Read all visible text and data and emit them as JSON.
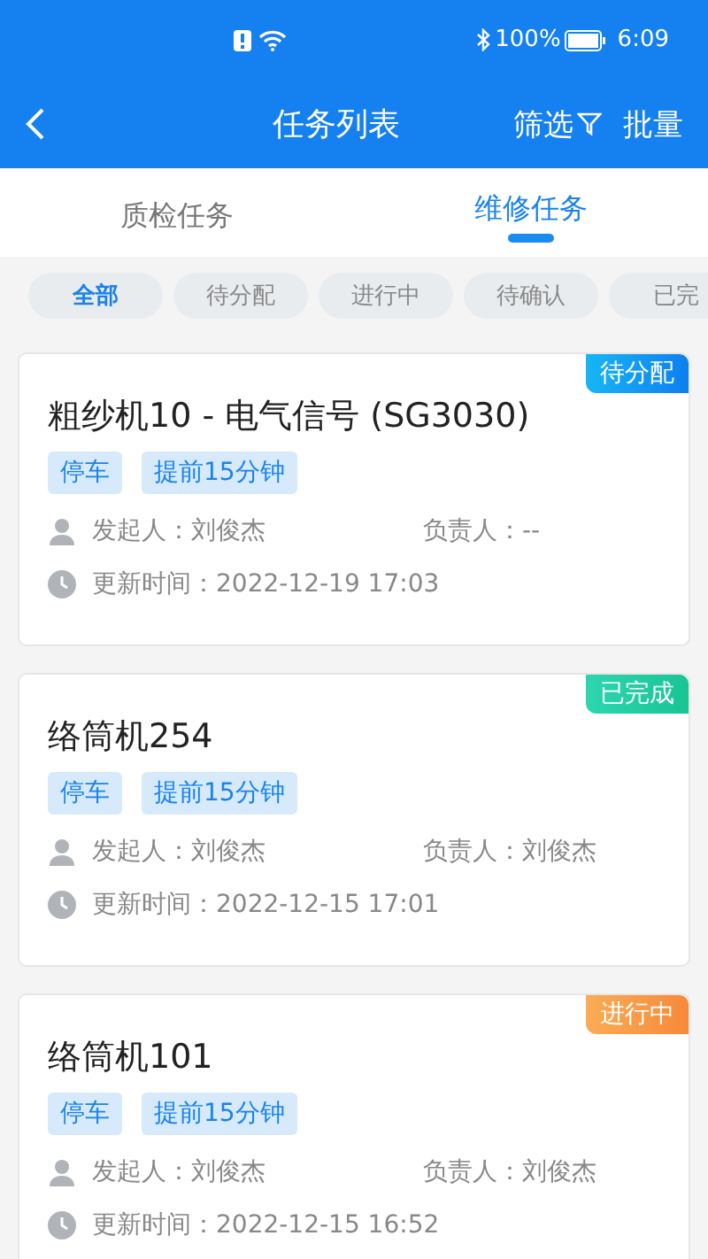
{
  "status_bar": {
    "battery": "100%",
    "time": "6:09"
  },
  "nav": {
    "title": "任务列表",
    "filter": "筛选",
    "batch": "批量"
  },
  "tabs": [
    {
      "label": "质检任务",
      "selected": false
    },
    {
      "label": "维修任务",
      "selected": true
    }
  ],
  "chips": [
    {
      "label": "全部",
      "selected": true
    },
    {
      "label": "待分配",
      "selected": false
    },
    {
      "label": "进行中",
      "selected": false
    },
    {
      "label": "待确认",
      "selected": false
    },
    {
      "label": "已完",
      "selected": false
    }
  ],
  "cards": [
    {
      "title": "粗纱机10 - 电气信号 (SG3030)",
      "status": "待分配",
      "kind": "pending",
      "tags": [
        "停车",
        "提前15分钟"
      ],
      "initiator": "发起人：刘俊杰",
      "assignee": "负责人：--",
      "updated": "更新时间：2022-12-19 17:03"
    },
    {
      "title": "络筒机254",
      "status": "已完成",
      "kind": "done",
      "tags": [
        "停车",
        "提前15分钟"
      ],
      "initiator": "发起人：刘俊杰",
      "assignee": "负责人：刘俊杰",
      "updated": "更新时间：2022-12-15 17:01"
    },
    {
      "title": "络筒机101",
      "status": "进行中",
      "kind": "progress",
      "tags": [
        "停车",
        "提前15分钟"
      ],
      "initiator": "发起人：刘俊杰",
      "assignee": "负责人：刘俊杰",
      "updated": "更新时间：2022-12-15 16:52"
    }
  ]
}
